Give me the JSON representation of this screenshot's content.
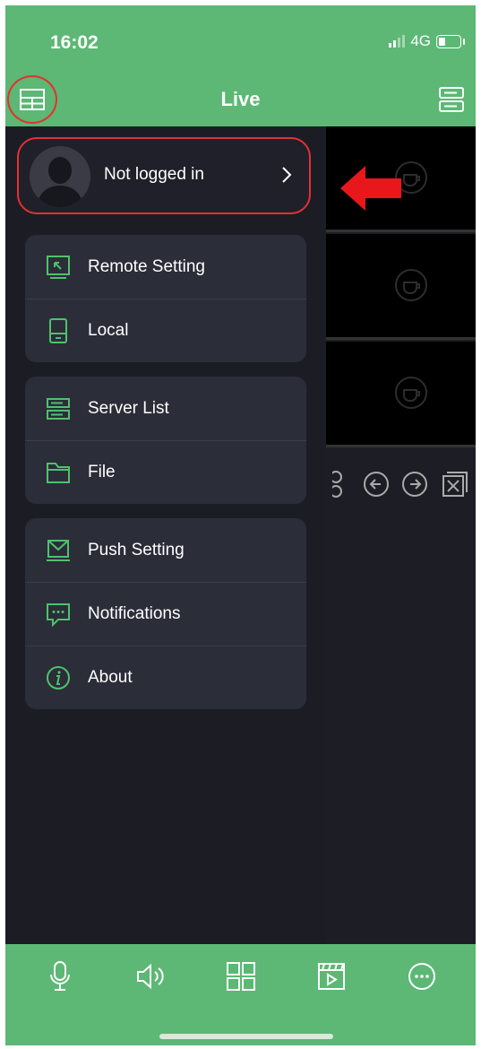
{
  "status": {
    "time": "16:02",
    "network": "4G"
  },
  "header": {
    "title": "Live"
  },
  "profile": {
    "label": "Not logged in"
  },
  "menu": {
    "group1": [
      {
        "label": "Remote Setting",
        "icon": "remote-setting-icon"
      },
      {
        "label": "Local",
        "icon": "local-device-icon"
      }
    ],
    "group2": [
      {
        "label": "Server List",
        "icon": "server-list-icon"
      },
      {
        "label": "File",
        "icon": "folder-icon"
      }
    ],
    "group3": [
      {
        "label": "Push Setting",
        "icon": "push-setting-icon"
      },
      {
        "label": "Notifications",
        "icon": "notifications-icon"
      },
      {
        "label": "About",
        "icon": "info-icon"
      }
    ]
  },
  "toolbar": [
    "microphone-icon",
    "speaker-icon",
    "grid-icon",
    "playback-icon",
    "more-icon"
  ],
  "colors": {
    "accent": "#5cb874",
    "drawer": "#1b1c24",
    "card": "#2b2d39",
    "highlight": "#e53030"
  }
}
